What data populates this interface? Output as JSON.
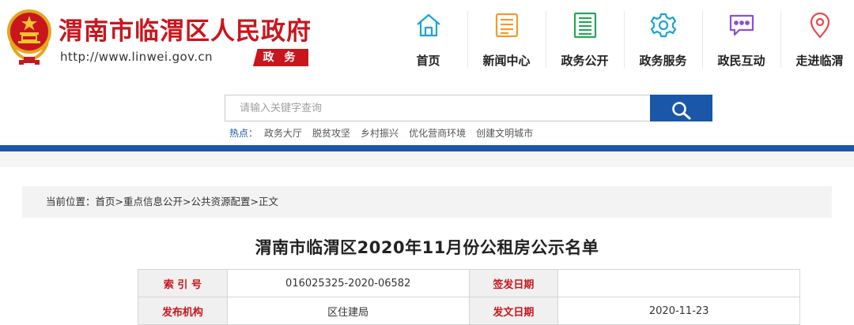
{
  "header": {
    "site_title": "渭南市临渭区人民政府",
    "site_url": "http://www.linwei.gov.cn",
    "site_badge": "政 务"
  },
  "nav": {
    "items": [
      {
        "label": "首页",
        "icon": "home-icon",
        "color": "#1aa3d8"
      },
      {
        "label": "新闻中心",
        "icon": "news-icon",
        "color": "#f39a2c"
      },
      {
        "label": "政务公开",
        "icon": "document-list-icon",
        "color": "#2aa557"
      },
      {
        "label": "政务服务",
        "icon": "gear-icon",
        "color": "#1aa3d8"
      },
      {
        "label": "政民互动",
        "icon": "chat-bubble-icon",
        "color": "#8a4fd8"
      },
      {
        "label": "走进临渭",
        "icon": "location-pin-icon",
        "color": "#e8484b"
      }
    ]
  },
  "search": {
    "placeholder": "请输入关键字查询",
    "button_icon": "search-icon"
  },
  "hotwords": {
    "label": "热点：",
    "items": [
      "政务大厅",
      "脱贫攻坚",
      "乡村振兴",
      "优化营商环境",
      "创建文明城市"
    ]
  },
  "breadcrumb": {
    "prefix": "当前位置：",
    "items": [
      "首页",
      "重点信息公开",
      "公共资源配置",
      "正文"
    ],
    "separator": ">"
  },
  "article": {
    "title": "渭南市临渭区2020年11月份公租房公示名单"
  },
  "meta_table": {
    "rows": [
      {
        "k1": "索 引 号",
        "v1": "016025325-2020-06582",
        "k2": "签发日期",
        "v2": ""
      },
      {
        "k1": "发布机构",
        "v1": "区住建局",
        "k2": "发文日期",
        "v2": "2020-11-23"
      }
    ]
  },
  "colors": {
    "brand_red": "#c8161d",
    "brand_blue": "#1a57a8"
  }
}
